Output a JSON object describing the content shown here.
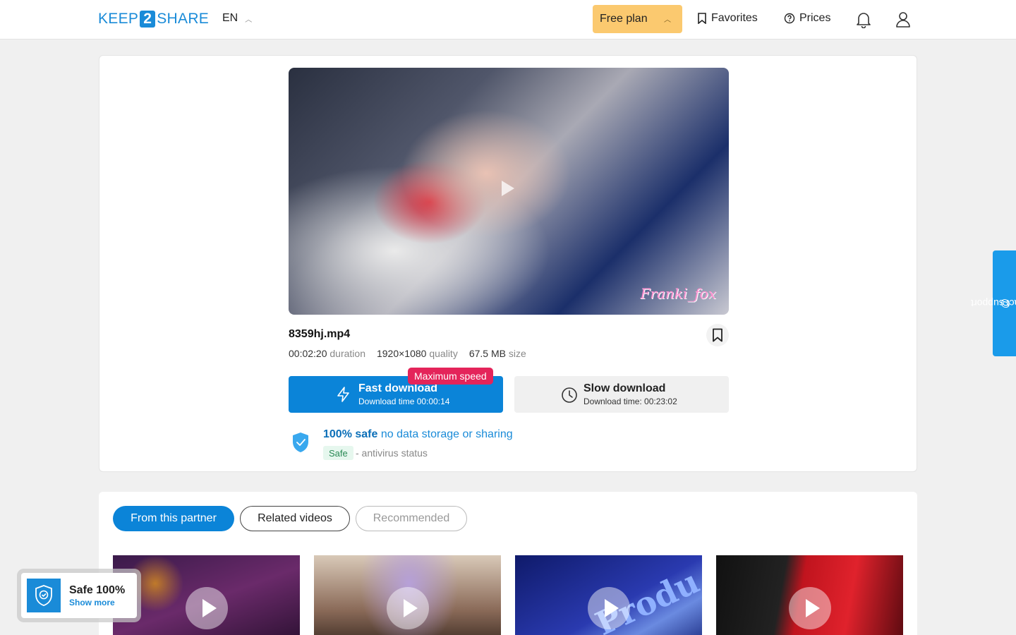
{
  "header": {
    "logo": {
      "left": "KEEP",
      "mid": "2",
      "right": "SHARE"
    },
    "language": "EN",
    "plan": "Free plan",
    "favorites": "Favorites",
    "prices": "Prices",
    "icons": {
      "bell": "bell-icon",
      "user": "user-icon",
      "bookmark": "bookmark-icon",
      "help": "help-circle-icon"
    }
  },
  "file": {
    "name": "8359hj.mp4",
    "duration_value": "00:02:20",
    "duration_label": "duration",
    "quality_value": "1920×1080",
    "quality_label": "quality",
    "size_value": "67.5 MB",
    "size_label": "size",
    "watermark": "Franki_fox"
  },
  "download": {
    "badge": "Maximum speed",
    "fast_title": "Fast download",
    "fast_sub": "Download time 00:00:14",
    "slow_title": "Slow download",
    "slow_sub": "Download time: 00:23:02"
  },
  "safety": {
    "strong": "100% safe",
    "rest": " no data storage or sharing",
    "tag": "Safe",
    "status": "- antivirus status"
  },
  "tabs": [
    {
      "label": "From this partner",
      "active": true
    },
    {
      "label": "Related videos",
      "active": false
    },
    {
      "label": "Recommended",
      "active": false
    }
  ],
  "thumbs": [
    {
      "overlay_text": ""
    },
    {
      "overlay_text": ""
    },
    {
      "overlay_text": "Produ"
    },
    {
      "overlay_text": ""
    }
  ],
  "safe_popup": {
    "title": "Safe 100%",
    "link": "Show more"
  },
  "support": "contact support",
  "colors": {
    "accent": "#0b84d8",
    "plan": "#fbc96f",
    "badge": "#e4245a"
  }
}
